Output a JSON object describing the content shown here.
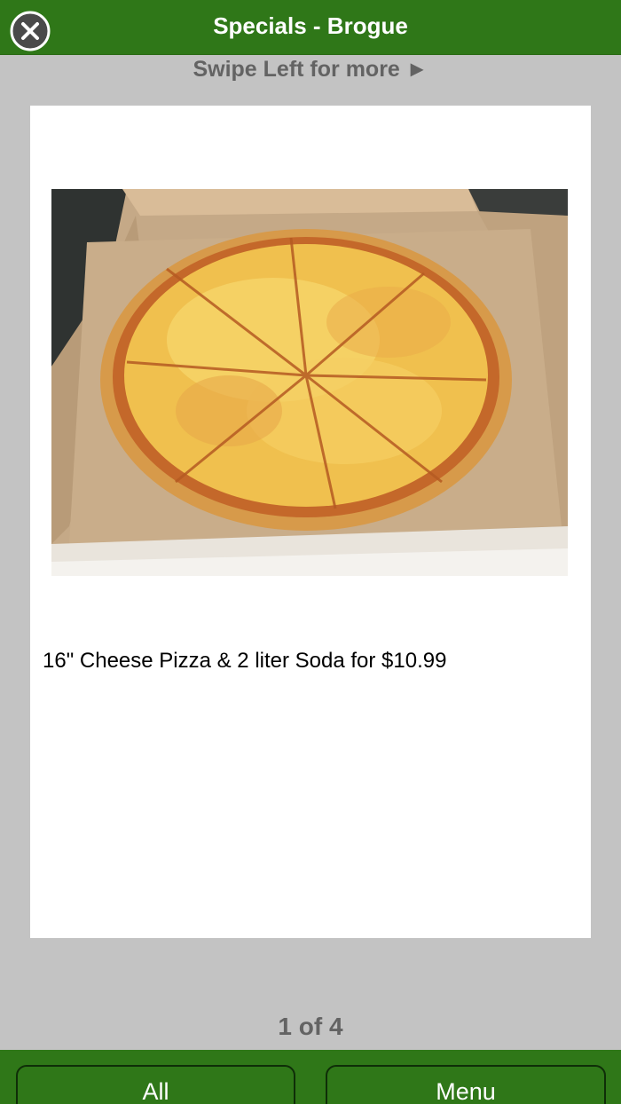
{
  "header": {
    "title": "Specials - Brogue",
    "close_icon": "close-circle-icon"
  },
  "swipe_hint": "Swipe Left for more ►",
  "special": {
    "description": "16\" Cheese Pizza & 2 liter Soda for $10.99",
    "image_subject": "cheese-pizza-in-box"
  },
  "pager": {
    "text": "1 of 4"
  },
  "bottom_nav": {
    "all_label": "All",
    "menu_label": "Menu"
  },
  "colors": {
    "bar_green": "#2f7718",
    "background_gray": "#c3c3c3",
    "hint_text": "#636363"
  }
}
